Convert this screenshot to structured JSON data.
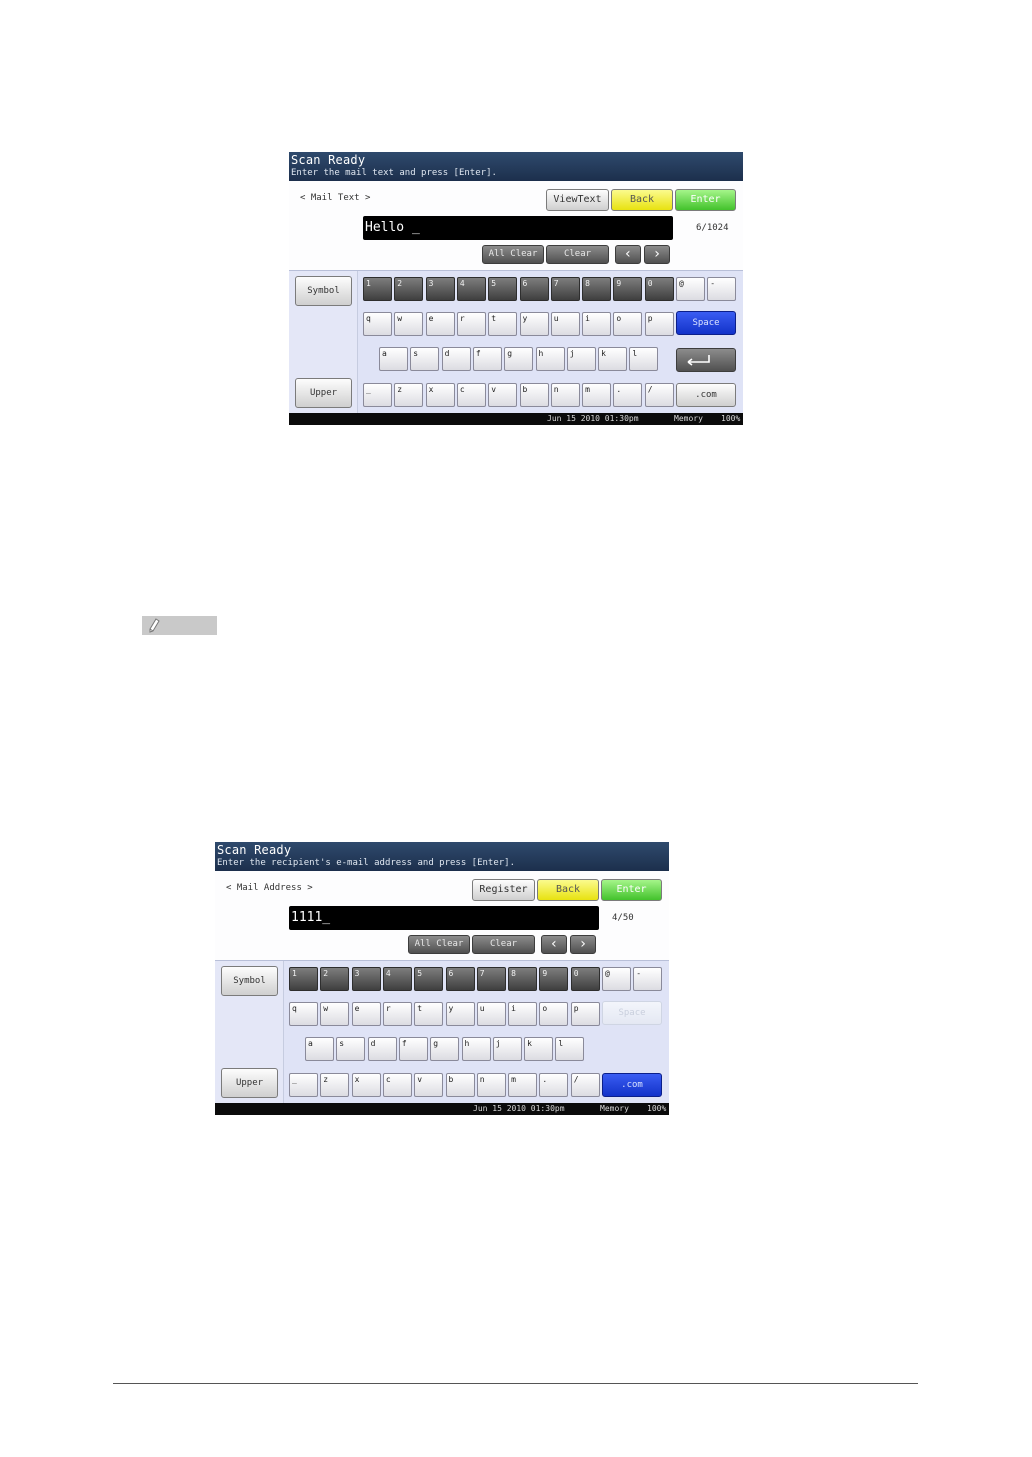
{
  "screens": [
    {
      "title": "Scan Ready",
      "subtitle": "Enter the mail text and press [Enter].",
      "mode_label": "< Mail Text >",
      "buttons": {
        "left": "ViewText",
        "back": "Back",
        "enter": "Enter"
      },
      "field_value": "Hello _",
      "counter": "6/1024",
      "all_clear": "All Clear",
      "clear": "Clear",
      "symbol": "Symbol",
      "upper": "Upper",
      "space": "Space",
      "dotcom": ".com",
      "status": {
        "date": "Jun 15 2010 01:30pm",
        "memory": "Memory",
        "percent": "100%"
      }
    },
    {
      "title": "Scan Ready",
      "subtitle": "Enter the recipient's e-mail address and press [Enter].",
      "mode_label": "< Mail Address >",
      "buttons": {
        "left": "Register",
        "back": "Back",
        "enter": "Enter"
      },
      "field_value": "1111_",
      "counter": "4/50",
      "all_clear": "All Clear",
      "clear": "Clear",
      "symbol": "Symbol",
      "upper": "Upper",
      "space": "Space",
      "dotcom": ".com",
      "status": {
        "date": "Jun 15 2010 01:30pm",
        "memory": "Memory",
        "percent": "100%"
      }
    }
  ],
  "keys": {
    "row1": [
      "1",
      "2",
      "3",
      "4",
      "5",
      "6",
      "7",
      "8",
      "9",
      "0",
      "@",
      "-"
    ],
    "row2": [
      "q",
      "w",
      "e",
      "r",
      "t",
      "y",
      "u",
      "i",
      "o",
      "p"
    ],
    "row3": [
      "a",
      "s",
      "d",
      "f",
      "g",
      "h",
      "j",
      "k",
      "l"
    ],
    "row4": [
      "_",
      "z",
      "x",
      "c",
      "v",
      "b",
      "n",
      "m",
      ".",
      "/"
    ]
  }
}
